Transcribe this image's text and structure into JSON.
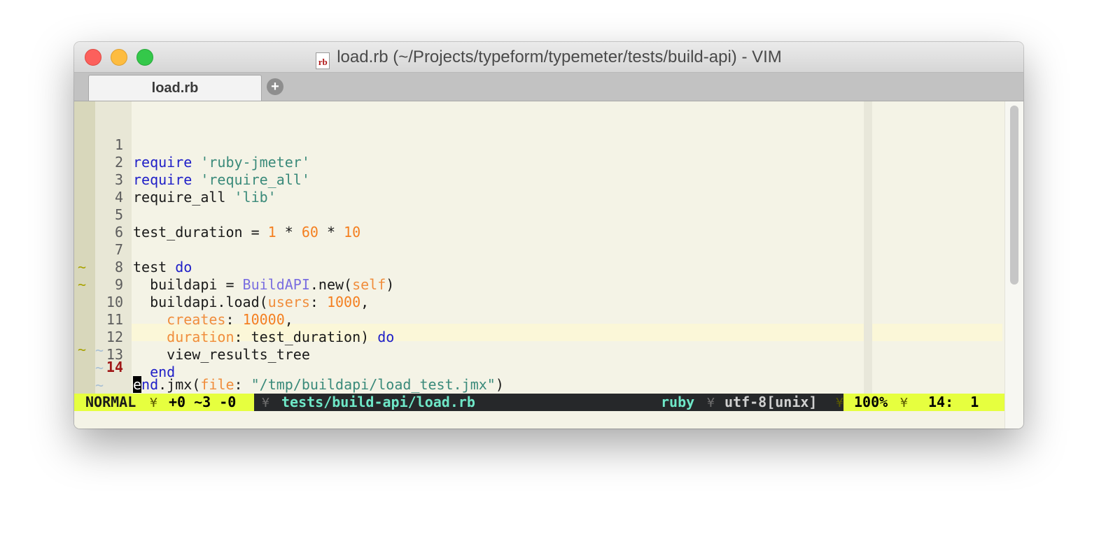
{
  "window": {
    "title": "load.rb (~/Projects/typeform/typemeter/tests/build-api) - VIM",
    "file_icon": "rb"
  },
  "tabs": [
    {
      "label": "load.rb",
      "active": true
    }
  ],
  "new_tab_icon": "plus-circle-icon",
  "editor": {
    "lines": [
      {
        "n": "1",
        "sign": ""
      },
      {
        "n": "2",
        "sign": ""
      },
      {
        "n": "3",
        "sign": ""
      },
      {
        "n": "4",
        "sign": ""
      },
      {
        "n": "5",
        "sign": ""
      },
      {
        "n": "6",
        "sign": ""
      },
      {
        "n": "7",
        "sign": ""
      },
      {
        "n": "8",
        "sign": ""
      },
      {
        "n": "9",
        "sign": "~"
      },
      {
        "n": "10",
        "sign": "~"
      },
      {
        "n": "11",
        "sign": ""
      },
      {
        "n": "12",
        "sign": ""
      },
      {
        "n": "13",
        "sign": ""
      },
      {
        "n": "14",
        "sign": "~"
      }
    ],
    "code": {
      "l1": {
        "kw": "require",
        "str": "'ruby-jmeter'"
      },
      "l2": {
        "kw": "require",
        "str": "'require_all'"
      },
      "l3": {
        "plain": "require_all ",
        "str": "'lib'"
      },
      "l5": {
        "plain": "test_duration = ",
        "n1": "1",
        "op1": " * ",
        "n2": "60",
        "op2": " * ",
        "n3": "10"
      },
      "l7": {
        "plain": "test ",
        "kw": "do"
      },
      "l8": {
        "plain": "  buildapi = ",
        "cls": "BuildAPI",
        "mid": ".new(",
        "self": "self",
        "end": ")"
      },
      "l9": {
        "plain": "  buildapi.load(",
        "sym": "users",
        "mid": ": ",
        "num": "1000",
        "end": ","
      },
      "l10": {
        "ind": "    ",
        "sym": "creates",
        "mid": ": ",
        "num": "10000",
        "end": ","
      },
      "l11": {
        "ind": "    ",
        "sym": "duration",
        "mid": ": test_duration) ",
        "kw": "do"
      },
      "l12": {
        "plain": "    view_results_tree"
      },
      "l13": {
        "ind": "  ",
        "kw": "end"
      },
      "l14": {
        "cursor_char": "e",
        "kw": "nd",
        "mid": ".jmx(",
        "sym": "file",
        "mid2": ": ",
        "str": "\"/tmp/buildapi/load_test.jmx\"",
        "end": ")"
      }
    },
    "empty_line_marker": "~"
  },
  "statusline": {
    "mode": "NORMAL",
    "git_stats": "+0 ~3 -0",
    "file_path": "tests/build-api/load.rb",
    "filetype": "ruby",
    "encoding": "utf-8[unix]",
    "percent": "100%",
    "position": "14:  1",
    "separator": "¥"
  }
}
